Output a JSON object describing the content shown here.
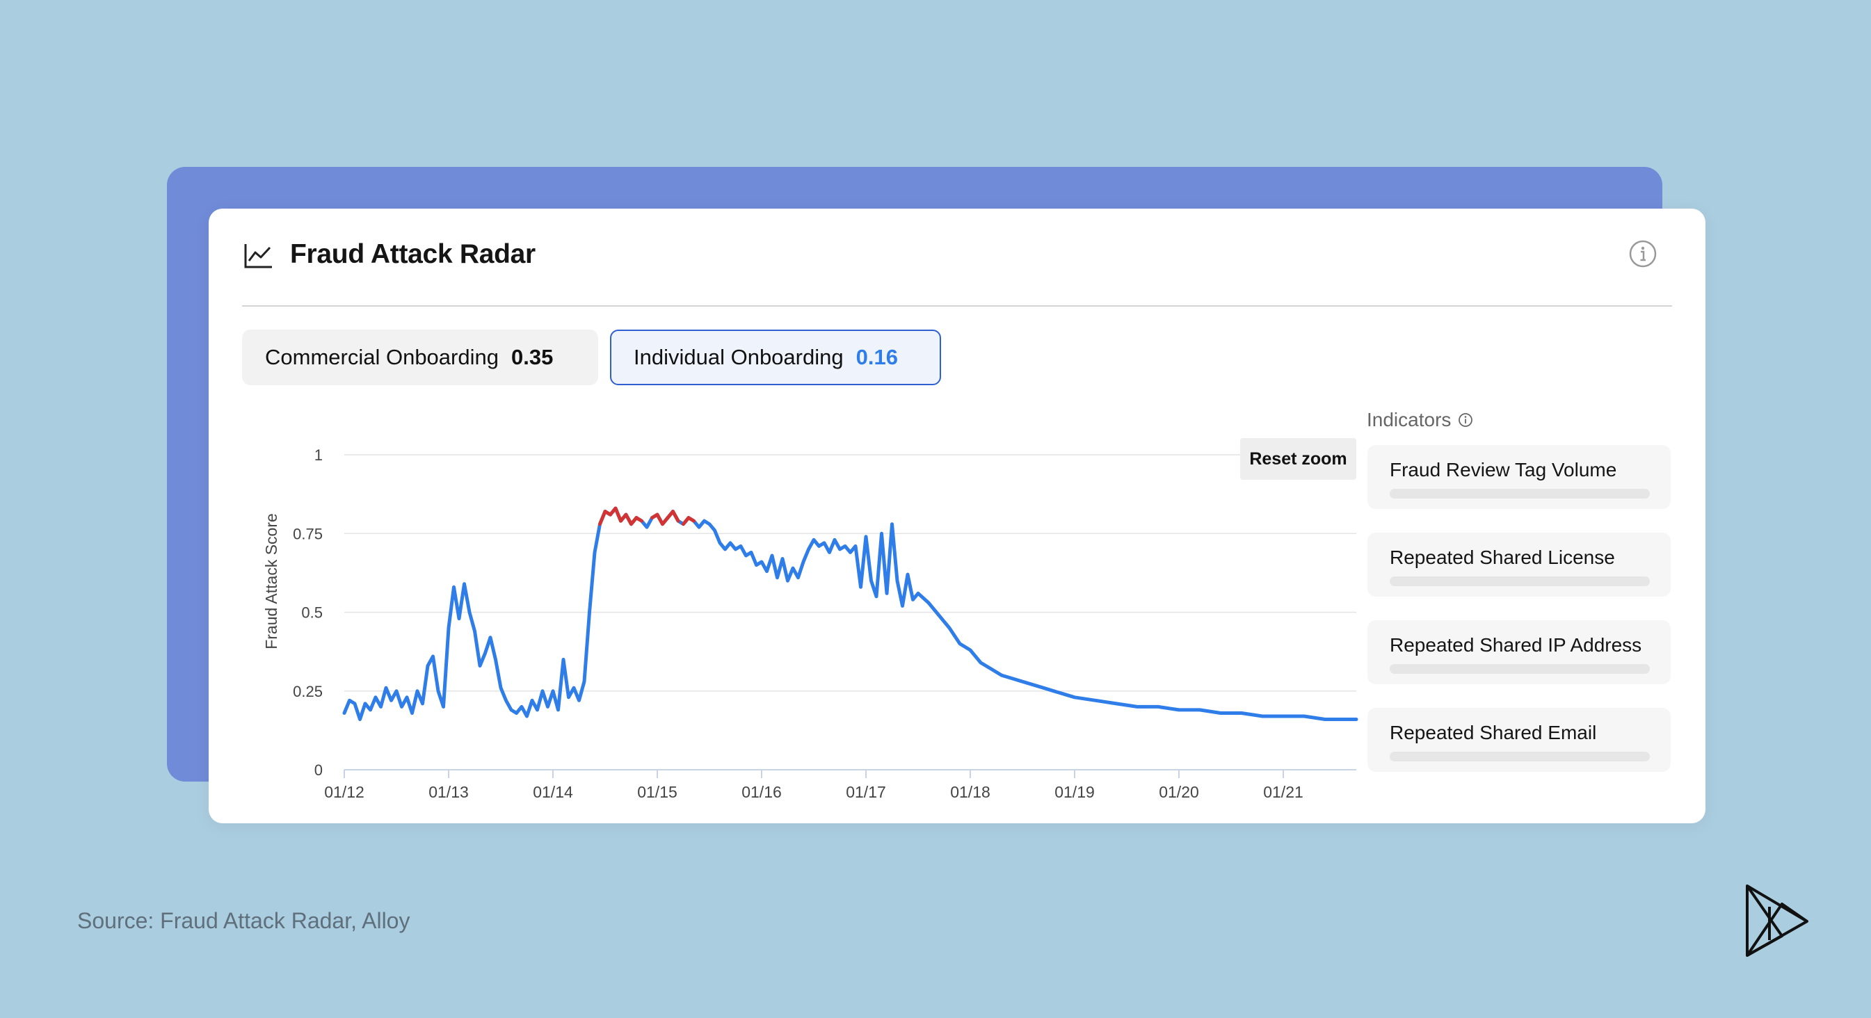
{
  "header": {
    "title": "Fraud Attack Radar",
    "chart_icon": "line-chart-icon",
    "info_icon": "info-icon"
  },
  "tabs": [
    {
      "label": "Commercial Onboarding",
      "value": "0.35",
      "selected": false
    },
    {
      "label": "Individual Onboarding",
      "value": "0.16",
      "selected": true
    }
  ],
  "reset_zoom_label": "Reset zoom",
  "indicators": {
    "title": "Indicators",
    "items": [
      {
        "label": "Fraud Review Tag Volume"
      },
      {
        "label": "Repeated Shared License"
      },
      {
        "label": "Repeated Shared IP Address"
      },
      {
        "label": "Repeated Shared Email"
      }
    ]
  },
  "source": "Source: Fraud Attack Radar, Alloy",
  "colors": {
    "background": "#abcde0",
    "back_card": "#708bd8",
    "series_line": "#2f7de8",
    "series_high": "#d23434",
    "selected_tab_border": "#2f5fd0"
  },
  "chart_data": {
    "type": "line",
    "title": "",
    "xlabel": "",
    "ylabel": "Fraud Attack Score",
    "xlim": [
      0,
      9.7
    ],
    "ylim": [
      0,
      1
    ],
    "yticks": [
      0,
      0.25,
      0.5,
      0.75,
      1
    ],
    "ytick_labels": [
      "0",
      "0.25",
      "0.5",
      "0.75",
      "1"
    ],
    "xtick_labels": [
      "01/12",
      "01/13",
      "01/14",
      "01/15",
      "01/16",
      "01/17",
      "01/18",
      "01/19",
      "01/20",
      "01/21"
    ],
    "high_threshold": 0.8,
    "grid": true,
    "series": [
      {
        "x": [
          0.0,
          0.05,
          0.1,
          0.15,
          0.2,
          0.25,
          0.3,
          0.35,
          0.4,
          0.45,
          0.5,
          0.55,
          0.6,
          0.65,
          0.7,
          0.75,
          0.8,
          0.85,
          0.9,
          0.95,
          1.0,
          1.05,
          1.1,
          1.15,
          1.2,
          1.25,
          1.3,
          1.35,
          1.4,
          1.45,
          1.5,
          1.55,
          1.6,
          1.65,
          1.7,
          1.75,
          1.8,
          1.85,
          1.9,
          1.95,
          2.0,
          2.05,
          2.1,
          2.15,
          2.2,
          2.25,
          2.3,
          2.35,
          2.4,
          2.45,
          2.5,
          2.55,
          2.6,
          2.65,
          2.7,
          2.75,
          2.8,
          2.85,
          2.9,
          2.95,
          3.0,
          3.05,
          3.1,
          3.15,
          3.2,
          3.25,
          3.3,
          3.35,
          3.4,
          3.45,
          3.5,
          3.55,
          3.6,
          3.65,
          3.7,
          3.75,
          3.8,
          3.85,
          3.9,
          3.95,
          4.0,
          4.05,
          4.1,
          4.15,
          4.2,
          4.25,
          4.3,
          4.35,
          4.4,
          4.45,
          4.5,
          4.55,
          4.6,
          4.65,
          4.7,
          4.75,
          4.8,
          4.85,
          4.9,
          4.95,
          5.0,
          5.05,
          5.1,
          5.15,
          5.2,
          5.25,
          5.3,
          5.35,
          5.4,
          5.45,
          5.5,
          5.6,
          5.7,
          5.8,
          5.9,
          6.0,
          6.1,
          6.2,
          6.3,
          6.4,
          6.5,
          6.6,
          6.7,
          6.8,
          6.9,
          7.0,
          7.2,
          7.4,
          7.6,
          7.8,
          8.0,
          8.2,
          8.4,
          8.6,
          8.8,
          9.0,
          9.2,
          9.4,
          9.6,
          9.7
        ],
        "y": [
          0.18,
          0.22,
          0.21,
          0.16,
          0.21,
          0.19,
          0.23,
          0.2,
          0.26,
          0.22,
          0.25,
          0.2,
          0.23,
          0.18,
          0.25,
          0.21,
          0.33,
          0.36,
          0.25,
          0.2,
          0.45,
          0.58,
          0.48,
          0.59,
          0.5,
          0.44,
          0.33,
          0.37,
          0.42,
          0.35,
          0.26,
          0.22,
          0.19,
          0.18,
          0.2,
          0.17,
          0.22,
          0.19,
          0.25,
          0.2,
          0.25,
          0.19,
          0.35,
          0.23,
          0.26,
          0.22,
          0.28,
          0.5,
          0.69,
          0.78,
          0.82,
          0.81,
          0.83,
          0.79,
          0.81,
          0.78,
          0.8,
          0.79,
          0.77,
          0.8,
          0.81,
          0.78,
          0.8,
          0.82,
          0.79,
          0.78,
          0.8,
          0.79,
          0.77,
          0.79,
          0.78,
          0.76,
          0.72,
          0.7,
          0.72,
          0.7,
          0.71,
          0.68,
          0.69,
          0.65,
          0.66,
          0.63,
          0.68,
          0.61,
          0.67,
          0.6,
          0.64,
          0.61,
          0.66,
          0.7,
          0.73,
          0.71,
          0.72,
          0.69,
          0.73,
          0.7,
          0.71,
          0.69,
          0.71,
          0.58,
          0.74,
          0.6,
          0.55,
          0.75,
          0.56,
          0.78,
          0.6,
          0.52,
          0.62,
          0.54,
          0.56,
          0.53,
          0.49,
          0.45,
          0.4,
          0.38,
          0.34,
          0.32,
          0.3,
          0.29,
          0.28,
          0.27,
          0.26,
          0.25,
          0.24,
          0.23,
          0.22,
          0.21,
          0.2,
          0.2,
          0.19,
          0.19,
          0.18,
          0.18,
          0.17,
          0.17,
          0.17,
          0.16,
          0.16,
          0.16
        ]
      }
    ]
  }
}
